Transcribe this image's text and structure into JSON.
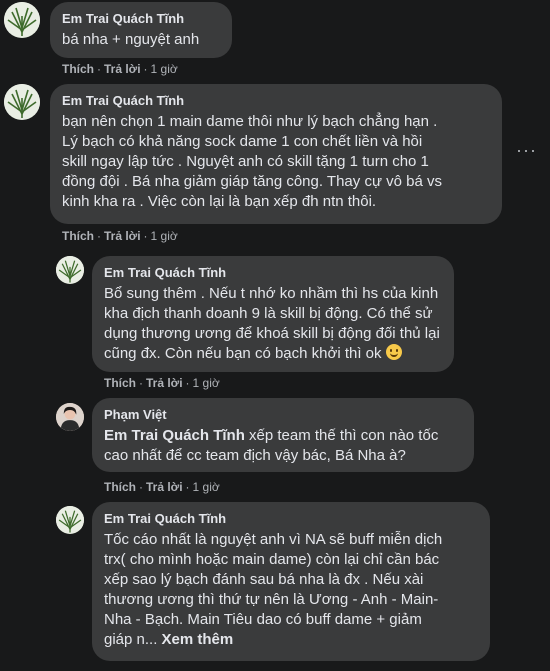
{
  "comments": [
    {
      "author": "Em Trai Quách Tĩnh",
      "lines": [
        "bá nha + nguyệt anh"
      ],
      "actions": {
        "like": "Thích",
        "reply": "Trả lời",
        "time": "1 giờ"
      }
    },
    {
      "author": "Em Trai Quách Tĩnh",
      "lines": [
        "bạn nên chọn 1 main dame thôi như lý bạch chẳng hạn .",
        "Lý bạch có khả năng sock dame 1 con chết liền và hồi",
        "skill ngay lập tức . Nguyệt anh có skill tặng 1 turn cho 1",
        "đồng đội . Bá nha giảm giáp tăng công. Thay cự vô bá vs",
        "kinh kha ra . Việc còn lại là bạn xếp đh ntn thôi."
      ],
      "actions": {
        "like": "Thích",
        "reply": "Trả lời",
        "time": "1 giờ"
      }
    },
    {
      "author": "Em Trai Quách Tĩnh",
      "lines": [
        "Bổ sung thêm . Nếu t nhớ ko nhầm thì hs của kinh",
        "kha địch thanh doanh 9 là skill bị động. Có thể sử",
        "dụng thương ương để khoá skill bị động đối thủ lại",
        "cũng đx. Còn nếu bạn có bạch khởi thì ok"
      ],
      "actions": {
        "like": "Thích",
        "reply": "Trả lời",
        "time": "1 giờ"
      }
    },
    {
      "author": "Phạm Việt",
      "mention": "Em Trai Quách Tĩnh",
      "line1_rest": " xếp team thế thì con nào tốc",
      "line2": "cao nhất để cc team địch vậy bác, Bá Nha à?",
      "actions": {
        "like": "Thích",
        "reply": "Trả lời",
        "time": "1 giờ"
      }
    },
    {
      "author": "Em Trai Quách Tĩnh",
      "lines": [
        "Tốc cáo nhất là nguyệt anh vì NA sẽ buff miễn dịch",
        "trx( cho mình hoặc main dame) còn lại chỉ cần bác",
        "xếp sao lý bạch đánh sau bá nha là đx . Nếu xài",
        "thương ương thì thứ tự nên là Ương - Anh - Main-",
        "Nha - Bạch. Main Tiêu dao có buff dame + giảm"
      ],
      "last_line": "giáp n...",
      "see_more": "Xem thêm"
    }
  ],
  "menu_icon": "more-horizontal-icon",
  "colors": {
    "bubble": "#3a3b3c",
    "background": "#18191a",
    "text": "#e4e6eb",
    "secondary": "#b0b3b8"
  }
}
